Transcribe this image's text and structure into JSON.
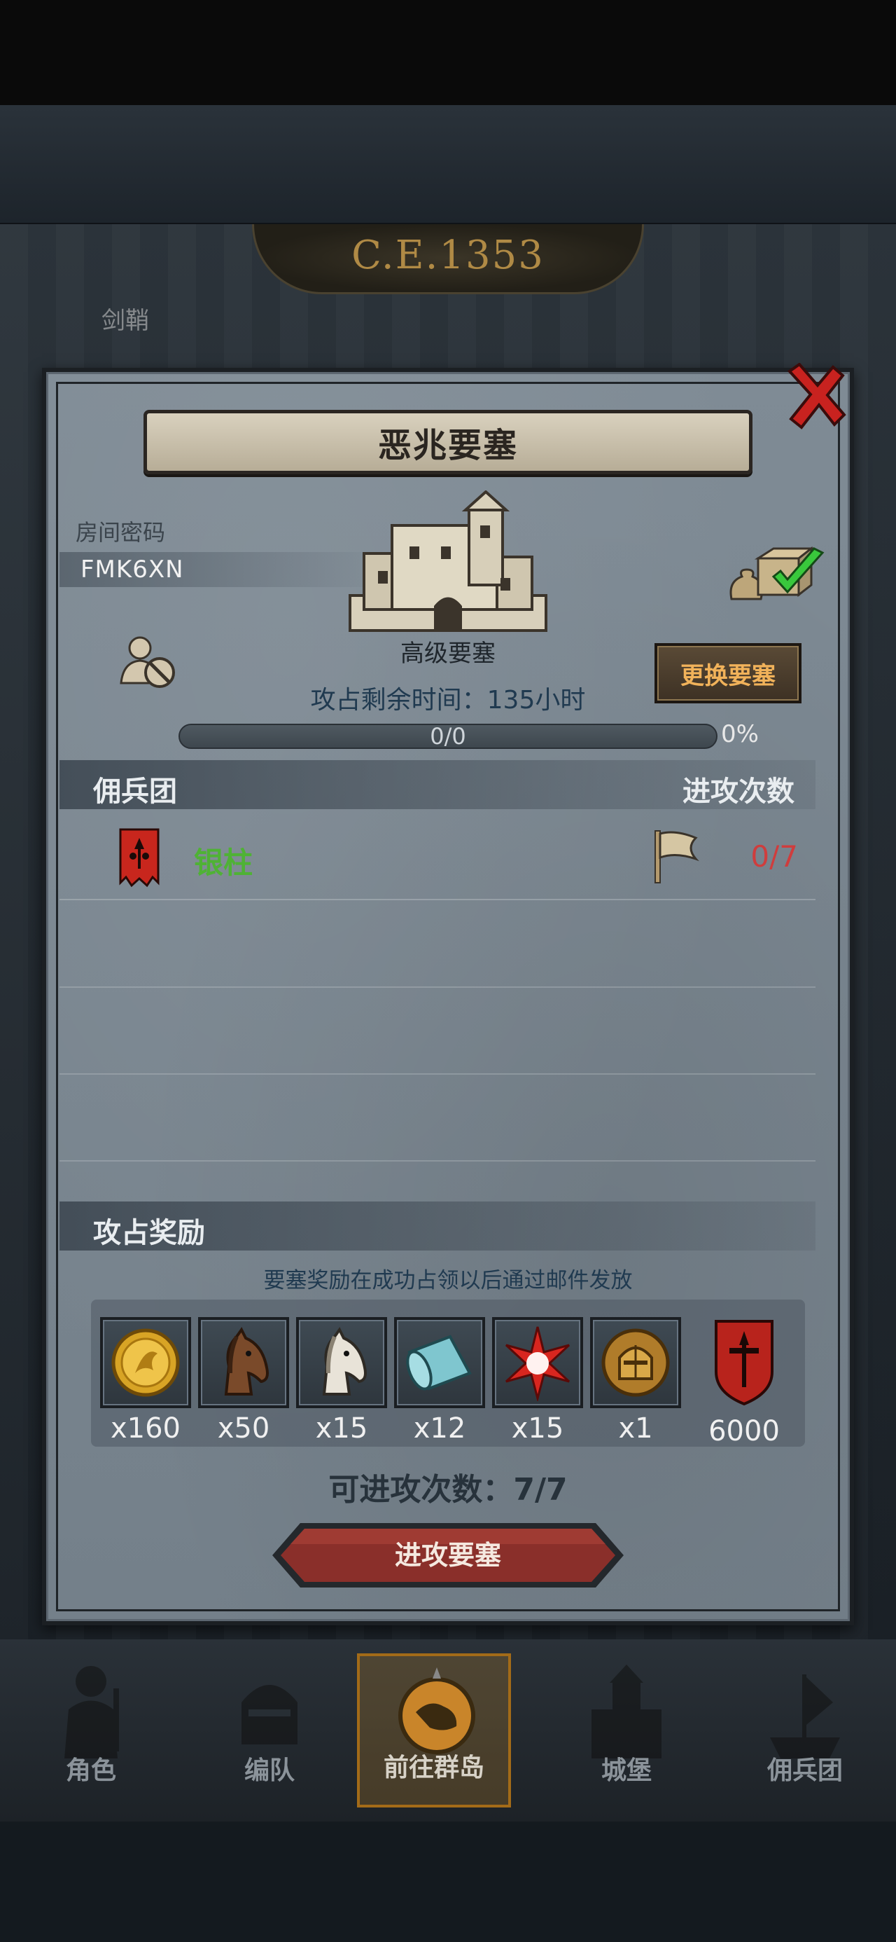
{
  "background": {
    "year": "C.E.1353",
    "map_label": "剑鞘"
  },
  "dialog": {
    "title": "恶兆要塞",
    "room_code_label": "房间密码",
    "room_code": "FMK6XN",
    "fortress_level": "高级要塞",
    "change_fortress_label": "更换要塞",
    "remaining_time": "攻占剩余时间：135小时",
    "progress": {
      "text": "0/0",
      "percent_label": "0%",
      "fraction": 0
    },
    "mercenary_section": {
      "title": "佣兵团",
      "attacks_header": "进攻次数"
    },
    "mercenaries": [
      {
        "name": "银柱",
        "attacks": "0/7",
        "name_color": "#4fb235"
      }
    ],
    "reward_section": {
      "title": "攻占奖励",
      "note": "要塞奖励在成功占领以后通过邮件发放",
      "items": [
        {
          "icon": "gold-coin-icon",
          "qty": "x160"
        },
        {
          "icon": "brown-horse-icon",
          "qty": "x50"
        },
        {
          "icon": "white-horse-icon",
          "qty": "x15"
        },
        {
          "icon": "cloth-roll-icon",
          "qty": "x12"
        },
        {
          "icon": "red-star-icon",
          "qty": "x15"
        },
        {
          "icon": "knight-helmet-medal-icon",
          "qty": "x1"
        },
        {
          "icon": "mercenary-crest-icon",
          "qty": "6000"
        }
      ]
    },
    "attacks_available": "可进攻次数：7/7",
    "attack_button_label": "进攻要塞"
  },
  "bottom_nav": [
    {
      "label": "角色",
      "icon": "knight-icon",
      "active": false
    },
    {
      "label": "编队",
      "icon": "helmet-icon",
      "active": false
    },
    {
      "label": "前往群岛",
      "icon": "compass-map-icon",
      "active": true
    },
    {
      "label": "城堡",
      "icon": "castle-icon",
      "active": false
    },
    {
      "label": "佣兵团",
      "icon": "mercenary-ship-icon",
      "active": false
    }
  ],
  "colors": {
    "accent_gold": "#f1b25a",
    "merc_name_green": "#4fb235",
    "attack_count_red": "#cf3d3d",
    "attack_button_red": "#8a2f2a"
  }
}
